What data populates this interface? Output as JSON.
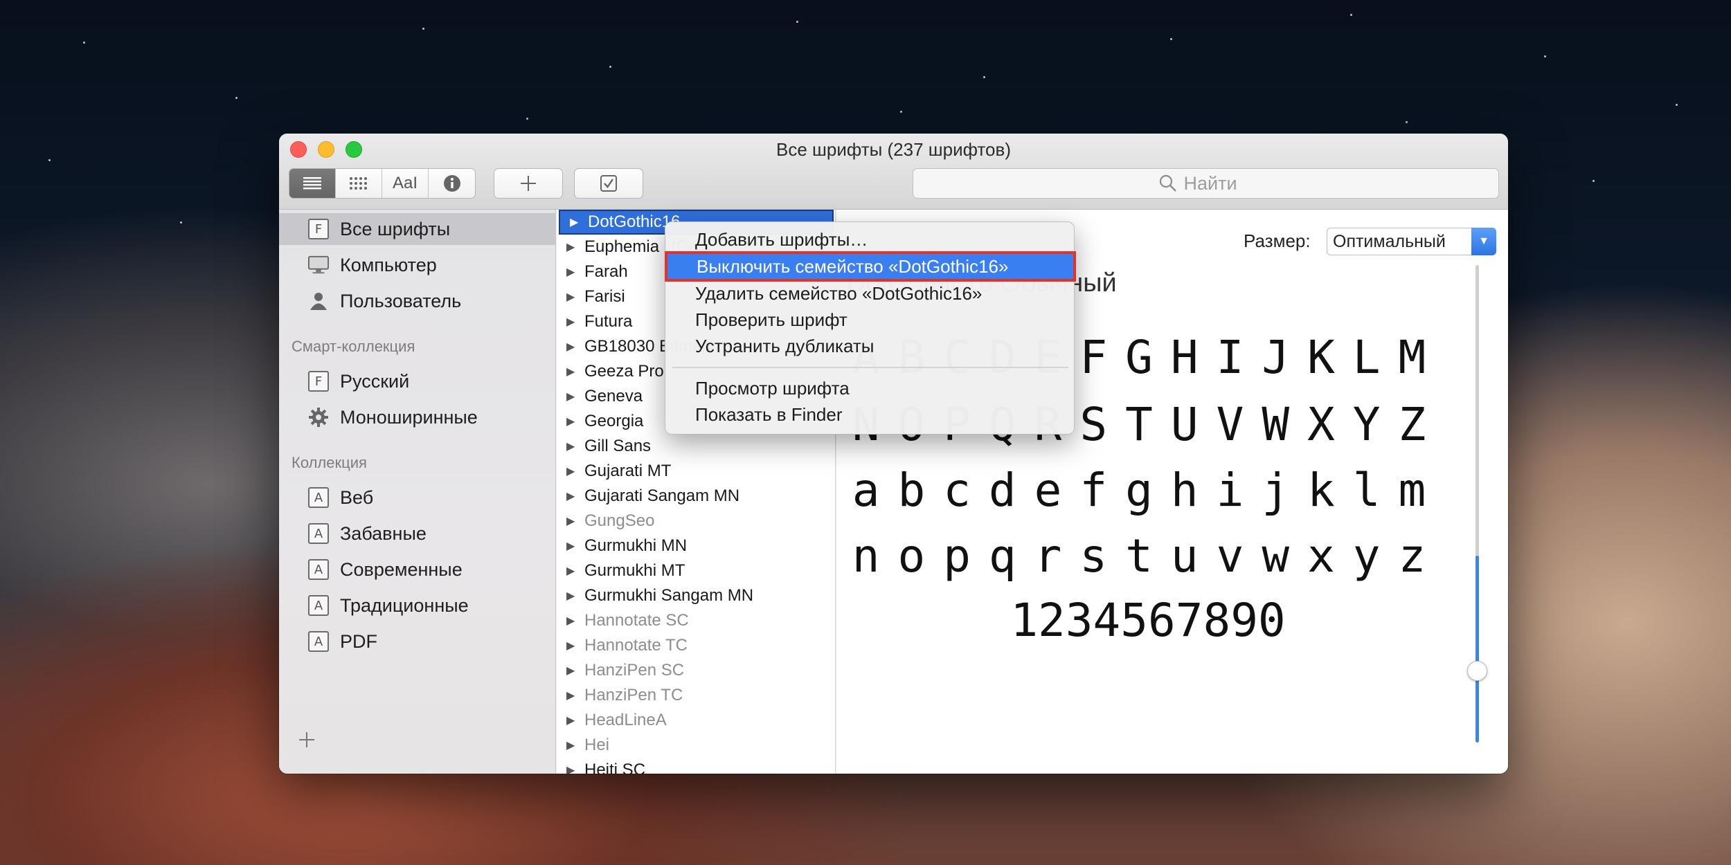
{
  "window": {
    "title": "Все шрифты (237 шрифтов)"
  },
  "toolbar": {
    "view_buttons": [
      {
        "name": "list-view",
        "icon": "list-icon"
      },
      {
        "name": "grid-view",
        "icon": "grid-icon"
      },
      {
        "name": "sample-view",
        "icon": "sample-text-icon",
        "label": "AaI"
      },
      {
        "name": "info-view",
        "icon": "info-icon"
      }
    ],
    "add_icon": "plus-icon",
    "validate_icon": "checkbox-icon",
    "search_placeholder": "Найти"
  },
  "sidebar": {
    "library_items": [
      {
        "label": "Все шрифты",
        "icon": "font-book-icon",
        "selected": true
      },
      {
        "label": "Компьютер",
        "icon": "computer-icon"
      },
      {
        "label": "Пользователь",
        "icon": "user-icon"
      }
    ],
    "smart_header": "Смарт-коллекция",
    "smart_items": [
      {
        "label": "Русский",
        "icon": "font-book-icon"
      },
      {
        "label": "Моноширинные",
        "icon": "gear-icon"
      }
    ],
    "collections_header": "Коллекция",
    "collection_items": [
      {
        "label": "Веб",
        "icon": "collection-icon"
      },
      {
        "label": "Забавные",
        "icon": "collection-icon"
      },
      {
        "label": "Современные",
        "icon": "collection-icon"
      },
      {
        "label": "Традиционные",
        "icon": "collection-icon"
      },
      {
        "label": "PDF",
        "icon": "collection-icon"
      }
    ]
  },
  "font_list": [
    {
      "name": "DotGothic16",
      "selected": true
    },
    {
      "name": "Euphemia UCAS"
    },
    {
      "name": "Farah"
    },
    {
      "name": "Farisi"
    },
    {
      "name": "Futura"
    },
    {
      "name": "GB18030 Bitmap"
    },
    {
      "name": "Geeza Pro"
    },
    {
      "name": "Geneva"
    },
    {
      "name": "Georgia"
    },
    {
      "name": "Gill Sans"
    },
    {
      "name": "Gujarati MT"
    },
    {
      "name": "Gujarati Sangam MN"
    },
    {
      "name": "GungSeo",
      "disabled": true
    },
    {
      "name": "Gurmukhi MN"
    },
    {
      "name": "Gurmukhi MT"
    },
    {
      "name": "Gurmukhi Sangam MN"
    },
    {
      "name": "Hannotate SC",
      "disabled": true
    },
    {
      "name": "Hannotate TC",
      "disabled": true
    },
    {
      "name": "HanziPen SC",
      "disabled": true
    },
    {
      "name": "HanziPen TC",
      "disabled": true
    },
    {
      "name": "HeadLineA",
      "disabled": true
    },
    {
      "name": "Hei",
      "disabled": true
    },
    {
      "name": "Heiti SC"
    }
  ],
  "preview": {
    "size_label": "Размер:",
    "size_value": "Оптимальный",
    "face_name": "DotGothic16 Обычный",
    "glyph_rows": [
      "ABCDEFGHIJKLM",
      "NOPQRSTUVWXYZ",
      "abcdefghijklm",
      "nopqrstuvwxyz",
      "1234567890"
    ]
  },
  "context_menu": {
    "items": [
      {
        "label": "Добавить шрифты…"
      },
      {
        "label": "Выключить семейство «DotGothic16»",
        "highlighted": true
      },
      {
        "label": "Удалить семейство «DotGothic16»"
      },
      {
        "label": "Проверить шрифт"
      },
      {
        "label": "Устранить дубликаты"
      },
      {
        "label": "Просмотр шрифта"
      },
      {
        "label": "Показать в Finder"
      }
    ]
  },
  "colors": {
    "selection_blue": "#2f6fdc",
    "menu_highlight": "#3a7ff1",
    "highlight_outline": "#e2332b"
  }
}
